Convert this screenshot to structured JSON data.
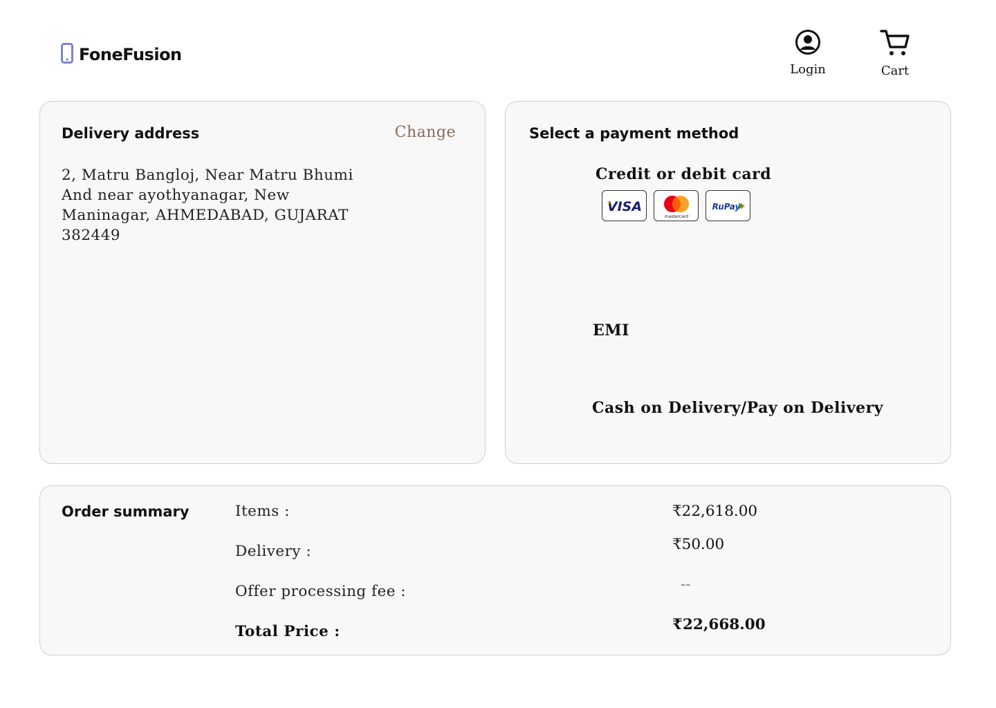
{
  "header": {
    "brand": "FoneFusion",
    "login_label": "Login",
    "cart_label": "Cart"
  },
  "address": {
    "title": "Delivery address",
    "change_label": "Change",
    "text": "2, Matru Bangloj, Near Matru Bhumi And near ayothyanagar, New Maninagar, AHMEDABAD, GUJARAT 382449"
  },
  "payment": {
    "title": "Select a payment method",
    "options": {
      "card": "Credit or debit card",
      "emi": "EMI",
      "cod": "Cash on Delivery/Pay on Delivery"
    },
    "card_brands": {
      "visa": "VISA",
      "mastercard": "mastercard",
      "rupay": "RuPay"
    }
  },
  "summary": {
    "title": "Order summary",
    "items_label": "Items :",
    "items_value": "₹22,618.00",
    "delivery_label": "Delivery :",
    "delivery_value": "₹50.00",
    "fee_label": "Offer processing fee :",
    "fee_value": "--",
    "total_label": "Total Price :",
    "total_value": "₹22,668.00"
  },
  "colors": {
    "accent": "#8a6a5e",
    "brand_icon": "#7b83d6",
    "panel_bg": "#f8f8f8"
  }
}
